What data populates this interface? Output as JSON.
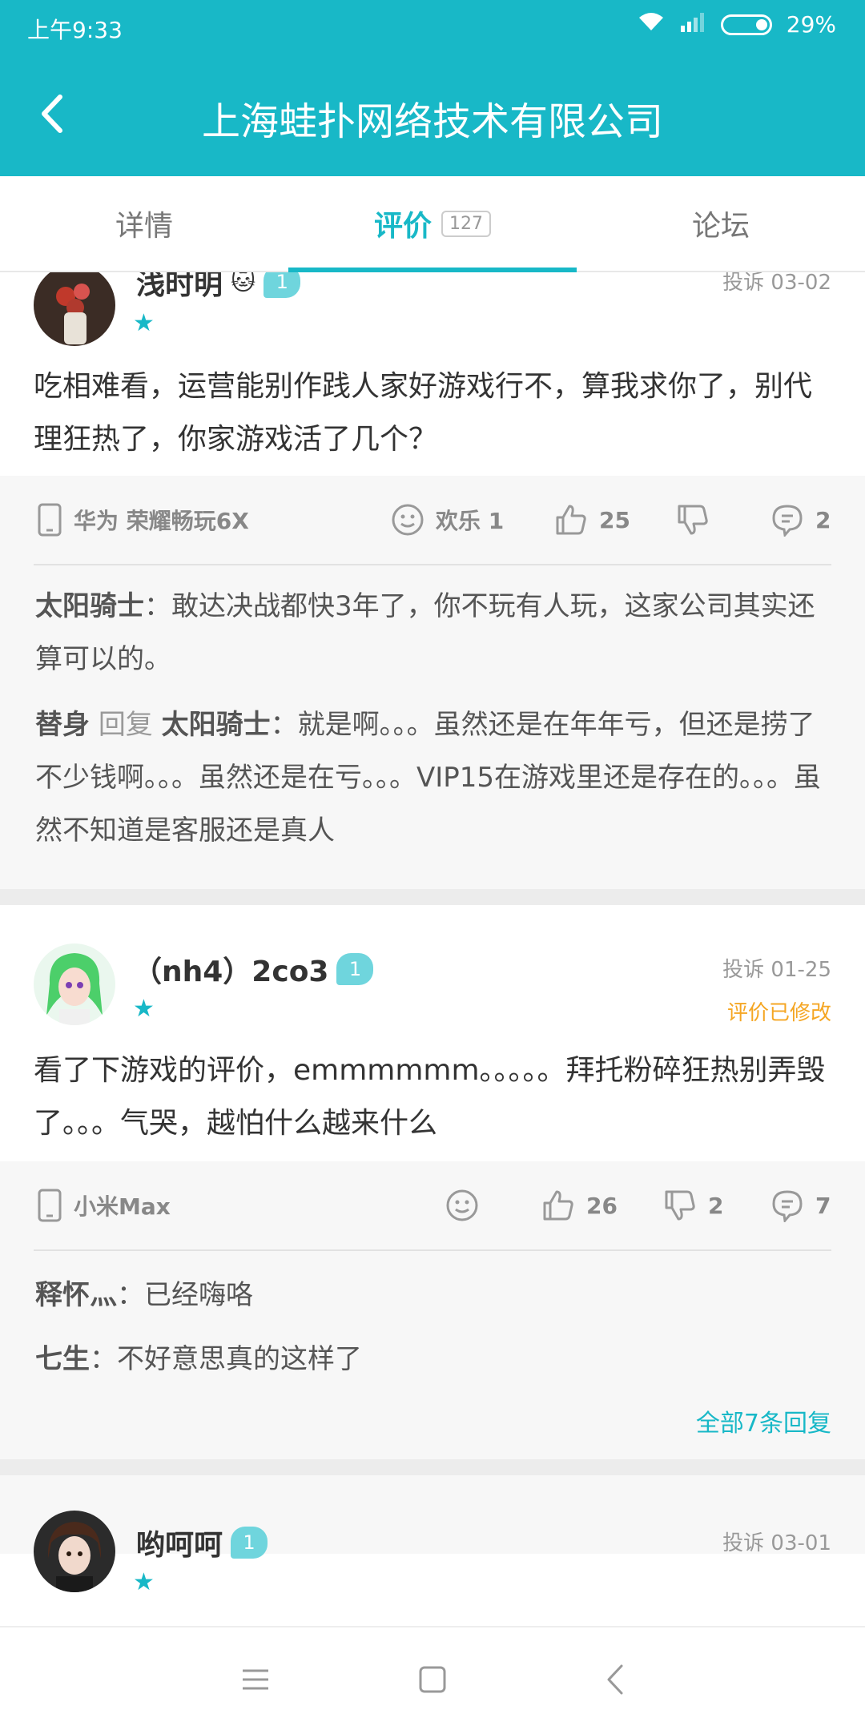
{
  "status_bar": {
    "time": "上午9:33",
    "battery": "29%"
  },
  "header": {
    "title": "上海蛙扑网络技术有限公司"
  },
  "tabs": [
    {
      "label": "详情"
    },
    {
      "label": "评价",
      "count": "127"
    },
    {
      "label": "论坛"
    }
  ],
  "colors": {
    "accent": "#18b8c7",
    "edited": "#f5a623"
  },
  "reviews": [
    {
      "username": "浅时明",
      "level": "1",
      "meta": "投诉 03-02",
      "text": "吃相难看，运营能别作践人家好游戏行不，算我求你了，别代理狂热了，你家游戏活了几个？",
      "device": "华为 荣耀畅玩6X",
      "mood": "欢乐 1",
      "likes": "25",
      "dislikes": "",
      "comments": "2",
      "replies": [
        {
          "name": "太阳骑士",
          "text": "：敢达决战都快3年了，你不玩有人玩，这家公司其实还算可以的。"
        },
        {
          "name": "替身",
          "reply_word": "回复",
          "target": "太阳骑士",
          "text": "：就是啊。。。虽然还是在年年亏，但还是捞了不少钱啊。。。虽然还是在亏。。。VIP15在游戏里还是存在的。。。虽然不知道是客服还是真人"
        }
      ]
    },
    {
      "username": "（nh4）2co3",
      "level": "1",
      "meta": "投诉 01-25",
      "edited": "评价已修改",
      "text": "看了下游戏的评价，emmmmmm。。。。。拜托粉碎狂热别弄毁了。。。气哭，越怕什么越来什么",
      "device": "小米Max",
      "likes": "26",
      "dislikes": "2",
      "comments": "7",
      "replies": [
        {
          "name": "释怀灬",
          "text": "：已经嗨咯"
        },
        {
          "name": "七生",
          "text": "：不好意思真的这样了"
        }
      ],
      "more_replies": "全部7条回复"
    },
    {
      "username": "哟呵呵",
      "level": "1",
      "meta": "投诉 03-01"
    }
  ]
}
